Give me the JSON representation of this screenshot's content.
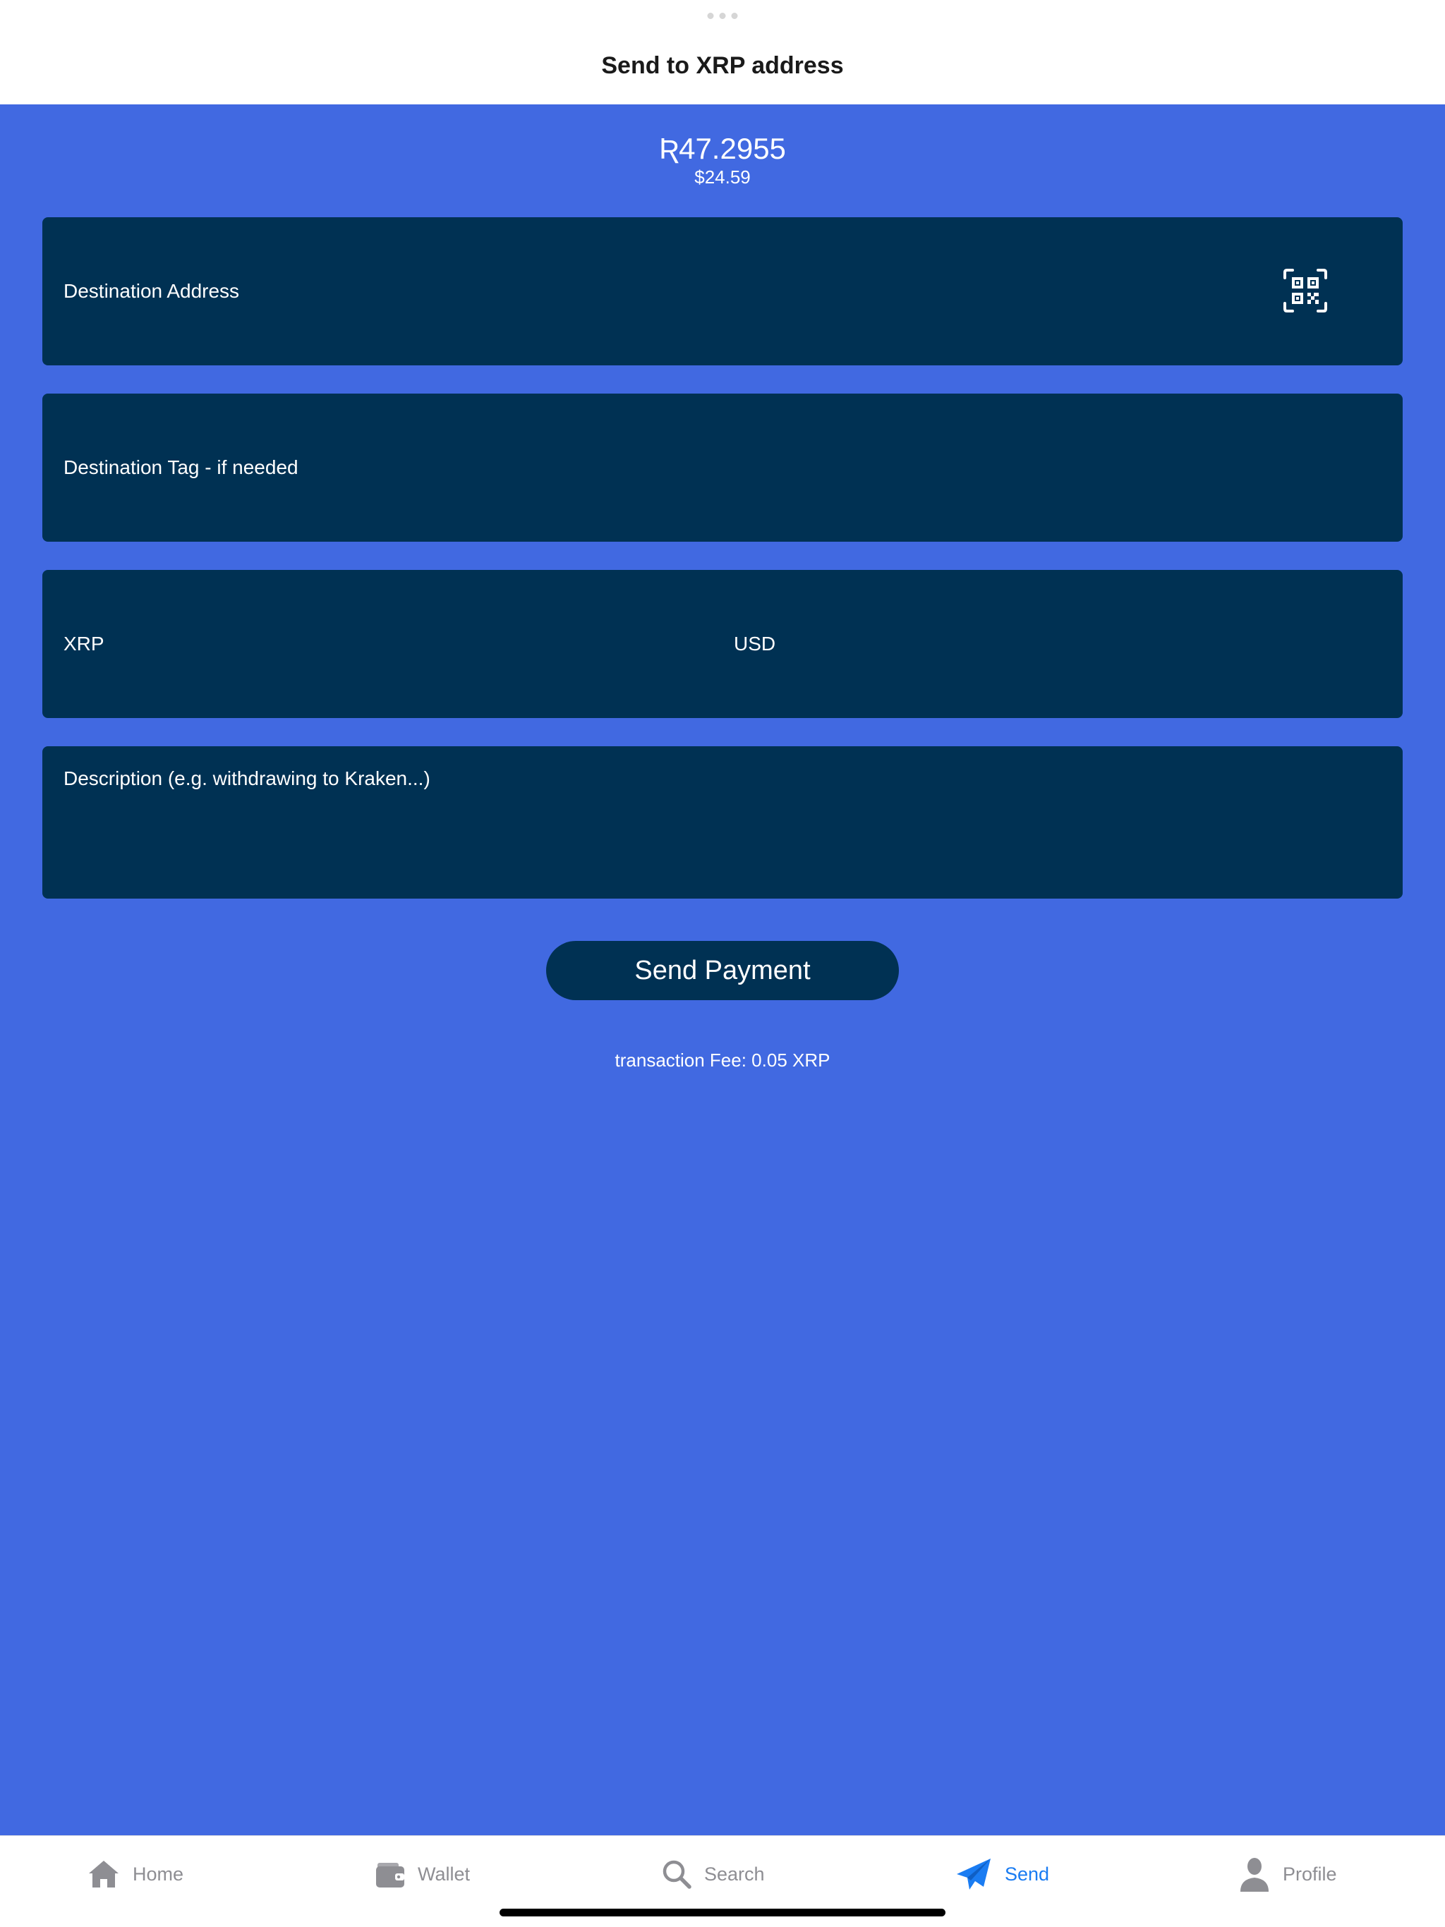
{
  "header": {
    "title": "Send to XRP address"
  },
  "balance": {
    "xrp": "Ʀ47.2955",
    "usd": "$24.59"
  },
  "form": {
    "destination_address_placeholder": "Destination Address",
    "destination_tag_placeholder": "Destination Tag - if needed",
    "xrp_amount_placeholder": "XRP",
    "usd_amount_placeholder": "USD",
    "description_placeholder": "Description (e.g. withdrawing to Kraken...)",
    "qr_icon": "qr-code-scan-icon"
  },
  "actions": {
    "send_label": "Send Payment",
    "fee_text": "transaction Fee: 0.05 XRP"
  },
  "tabbar": {
    "items": [
      {
        "label": "Home",
        "icon": "home-icon",
        "active": false
      },
      {
        "label": "Wallet",
        "icon": "wallet-icon",
        "active": false
      },
      {
        "label": "Search",
        "icon": "search-icon",
        "active": false
      },
      {
        "label": "Send",
        "icon": "paper-plane-icon",
        "active": true
      },
      {
        "label": "Profile",
        "icon": "person-icon",
        "active": false
      }
    ]
  },
  "colors": {
    "background": "#4169e1",
    "field": "#003153",
    "active_tab": "#1a7cf2",
    "inactive_tab": "#8e8e93"
  }
}
